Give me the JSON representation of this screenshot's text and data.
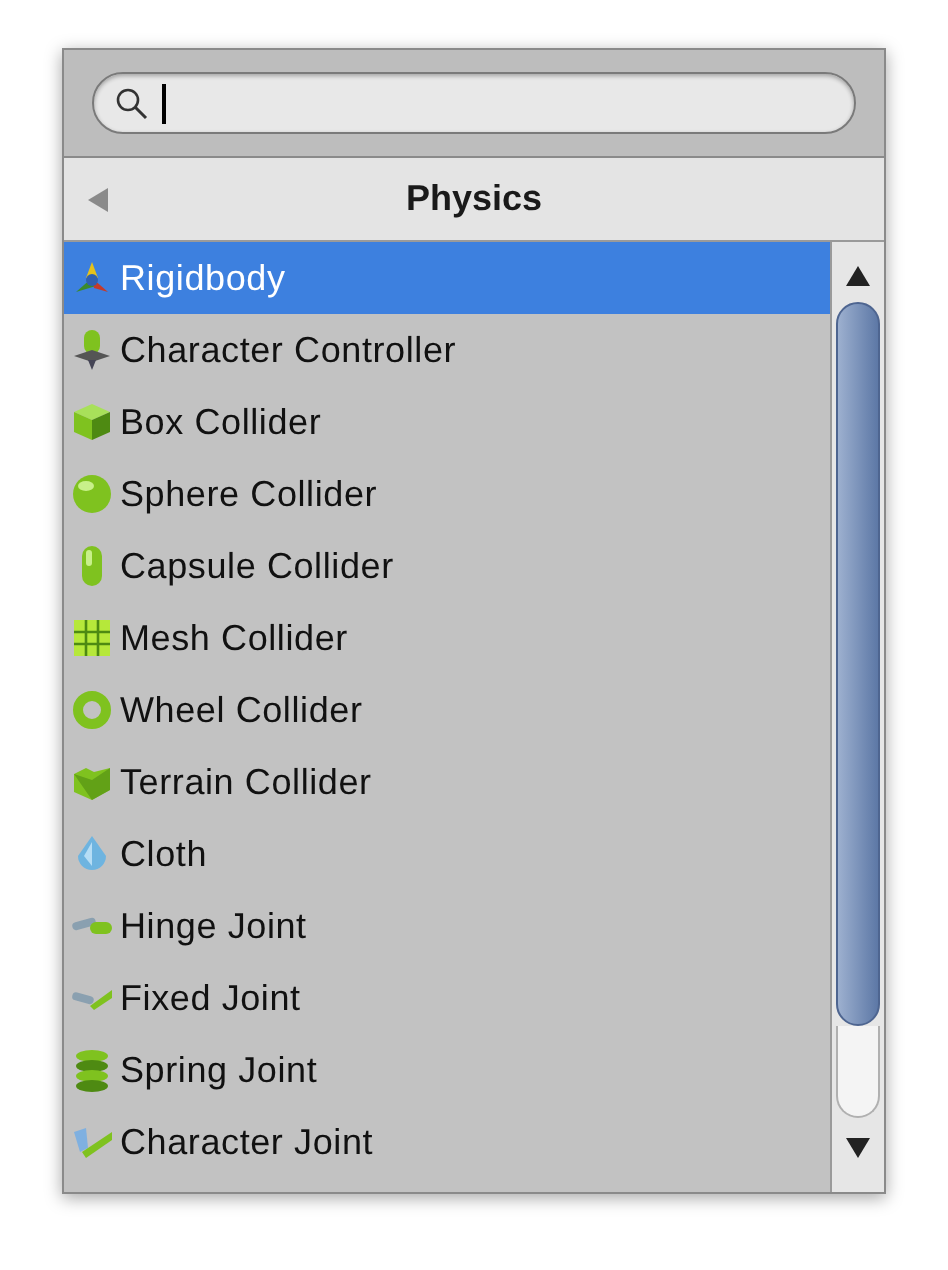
{
  "header": {
    "title": "Physics"
  },
  "items": [
    {
      "label": "Rigidbody",
      "selected": true
    },
    {
      "label": "Character Controller",
      "selected": false
    },
    {
      "label": "Box Collider",
      "selected": false
    },
    {
      "label": "Sphere Collider",
      "selected": false
    },
    {
      "label": "Capsule Collider",
      "selected": false
    },
    {
      "label": "Mesh Collider",
      "selected": false
    },
    {
      "label": "Wheel Collider",
      "selected": false
    },
    {
      "label": "Terrain Collider",
      "selected": false
    },
    {
      "label": "Cloth",
      "selected": false
    },
    {
      "label": "Hinge Joint",
      "selected": false
    },
    {
      "label": "Fixed Joint",
      "selected": false
    },
    {
      "label": "Spring Joint",
      "selected": false
    },
    {
      "label": "Character Joint",
      "selected": false
    }
  ]
}
